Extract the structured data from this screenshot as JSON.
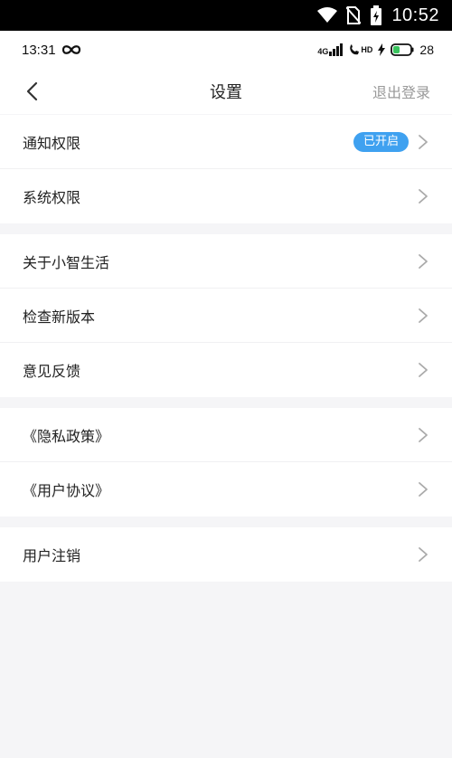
{
  "device_status": {
    "time": "10:52"
  },
  "phone_status": {
    "time": "13:31",
    "signal_label": "4G",
    "hd_label": "HD",
    "battery": "28"
  },
  "nav": {
    "title": "设置",
    "logout_label": "退出登录"
  },
  "groups": [
    {
      "items": [
        {
          "label": "通知权限",
          "badge": "已开启"
        },
        {
          "label": "系统权限"
        }
      ]
    },
    {
      "items": [
        {
          "label": "关于小智生活"
        },
        {
          "label": "检查新版本"
        },
        {
          "label": "意见反馈"
        }
      ]
    },
    {
      "items": [
        {
          "label": "《隐私政策》"
        },
        {
          "label": "《用户协议》"
        }
      ]
    },
    {
      "items": [
        {
          "label": "用户注销"
        }
      ]
    }
  ],
  "colors": {
    "accent": "#3fa1f0",
    "background": "#f5f5f7"
  }
}
